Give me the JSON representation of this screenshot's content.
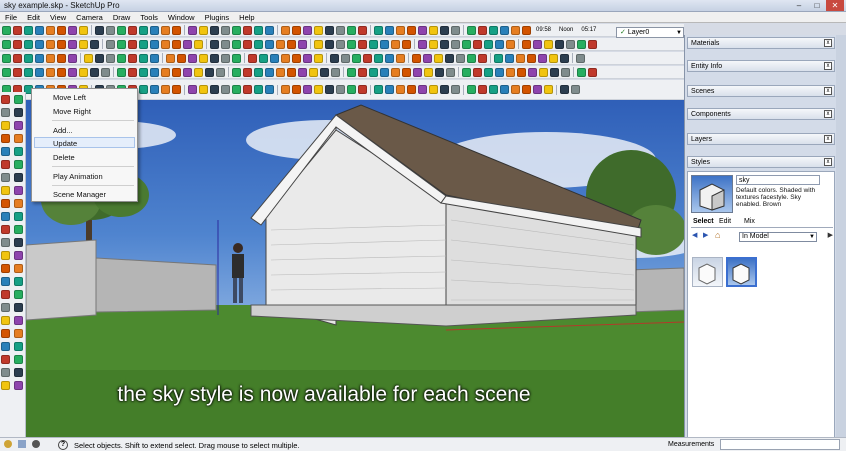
{
  "window": {
    "title": "sky example.skp - SketchUp Pro",
    "minimize": "–",
    "maximize": "□",
    "close": "✕"
  },
  "menu": [
    "File",
    "Edit",
    "View",
    "Camera",
    "Draw",
    "Tools",
    "Window",
    "Plugins",
    "Help"
  ],
  "toolbar": {
    "layer": "Layer0",
    "shadow_month_left": "09:58",
    "shadow_month_mid": "Noon",
    "shadow_time_right": "05:17"
  },
  "context_menu": {
    "items": [
      "Move Left",
      "Move Right",
      "Add...",
      "Update",
      "Delete",
      "Play Animation",
      "Scene Manager"
    ],
    "highlighted": "Update"
  },
  "tray": {
    "panels": [
      "Materials",
      "Entity Info",
      "Scenes",
      "Components",
      "Layers",
      "Styles"
    ],
    "styles": {
      "name": "sky",
      "description": "Default colors. Shaded with textures facestyle. Sky enabled. Brown",
      "tabs": [
        "Select",
        "Edit",
        "Mix"
      ],
      "collection": "In Model"
    }
  },
  "caption": "the sky style is now available for each scene",
  "status": {
    "hint": "Select objects. Shift to extend select. Drag mouse to select multiple.",
    "measurements": "Measurements",
    "help_icon": "?"
  },
  "icons": {
    "close": "x",
    "dropdown": "chevron-down-icon",
    "check": "✓",
    "back": "◀",
    "forward": "▶",
    "home": "⌂"
  }
}
